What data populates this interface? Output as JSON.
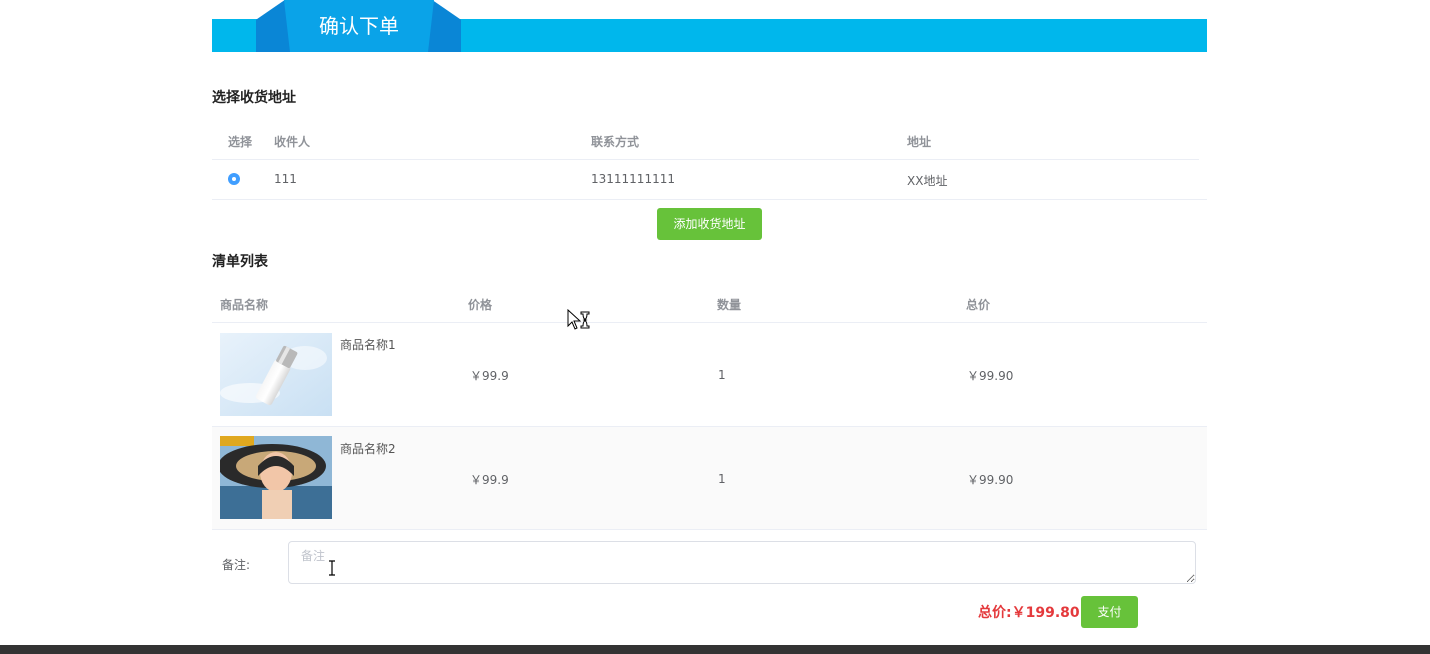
{
  "header": {
    "title": "确认下单"
  },
  "address_section": {
    "title": "选择收货地址",
    "columns": {
      "select": "选择",
      "recipient": "收件人",
      "contact": "联系方式",
      "address": "地址"
    },
    "rows": [
      {
        "selected": true,
        "recipient": "111",
        "contact": "13111111111",
        "address": "XX地址"
      }
    ],
    "add_button_label": "添加收货地址"
  },
  "items_section": {
    "title": "清单列表",
    "columns": {
      "name": "商品名称",
      "price": "价格",
      "quantity": "数量",
      "total": "总价"
    },
    "rows": [
      {
        "name": "商品名称1",
        "price": "￥99.9",
        "quantity": "1",
        "total": "￥99.90"
      },
      {
        "name": "商品名称2",
        "price": "￥99.9",
        "quantity": "1",
        "total": "￥99.90"
      }
    ]
  },
  "remark": {
    "label": "备注:",
    "placeholder": "备注",
    "value": ""
  },
  "summary": {
    "total_label": "总价:",
    "total_value": "￥199.80",
    "pay_button_label": "支付"
  },
  "colors": {
    "banner": "#00b7ec",
    "banner_tab": "#0aa3e8",
    "accent_green": "#67c23a",
    "radio_blue": "#409eff",
    "price_red": "#e4393c",
    "footer": "#333333"
  }
}
